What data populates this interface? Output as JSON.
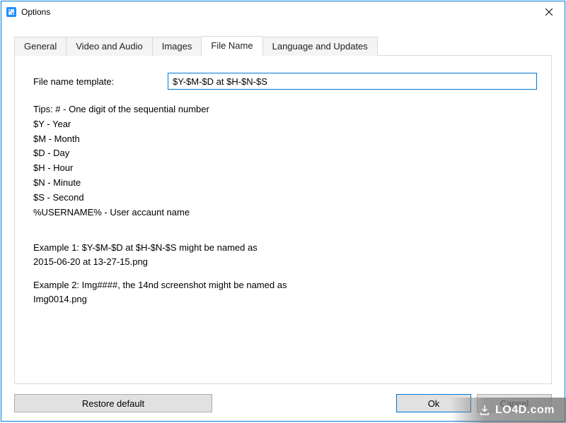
{
  "window": {
    "title": "Options"
  },
  "tabs": {
    "general": "General",
    "video_audio": "Video and Audio",
    "images": "Images",
    "file_name": "File Name",
    "language_updates": "Language and Updates"
  },
  "file_name_tab": {
    "template_label": "File name template:",
    "template_value": "$Y-$M-$D at $H-$N-$S",
    "tips_header": "Tips: # - One digit of the sequential number",
    "tip_year": "$Y - Year",
    "tip_month": "$M - Month",
    "tip_day": "$D - Day",
    "tip_hour": "$H - Hour",
    "tip_minute": "$N - Minute",
    "tip_second": "$S - Second",
    "tip_username": "%USERNAME% - User accaunt name",
    "example1_line1": "Example 1: $Y-$M-$D at $H-$N-$S might be named as",
    "example1_line2": "2015-06-20 at 13-27-15.png",
    "example2_line1": "Example 2: Img####, the 14nd screenshot might be named as",
    "example2_line2": "Img0014.png"
  },
  "buttons": {
    "restore_default": "Restore default",
    "ok": "Ok",
    "cancel": "Cancel"
  },
  "watermark": "LO4D.com"
}
